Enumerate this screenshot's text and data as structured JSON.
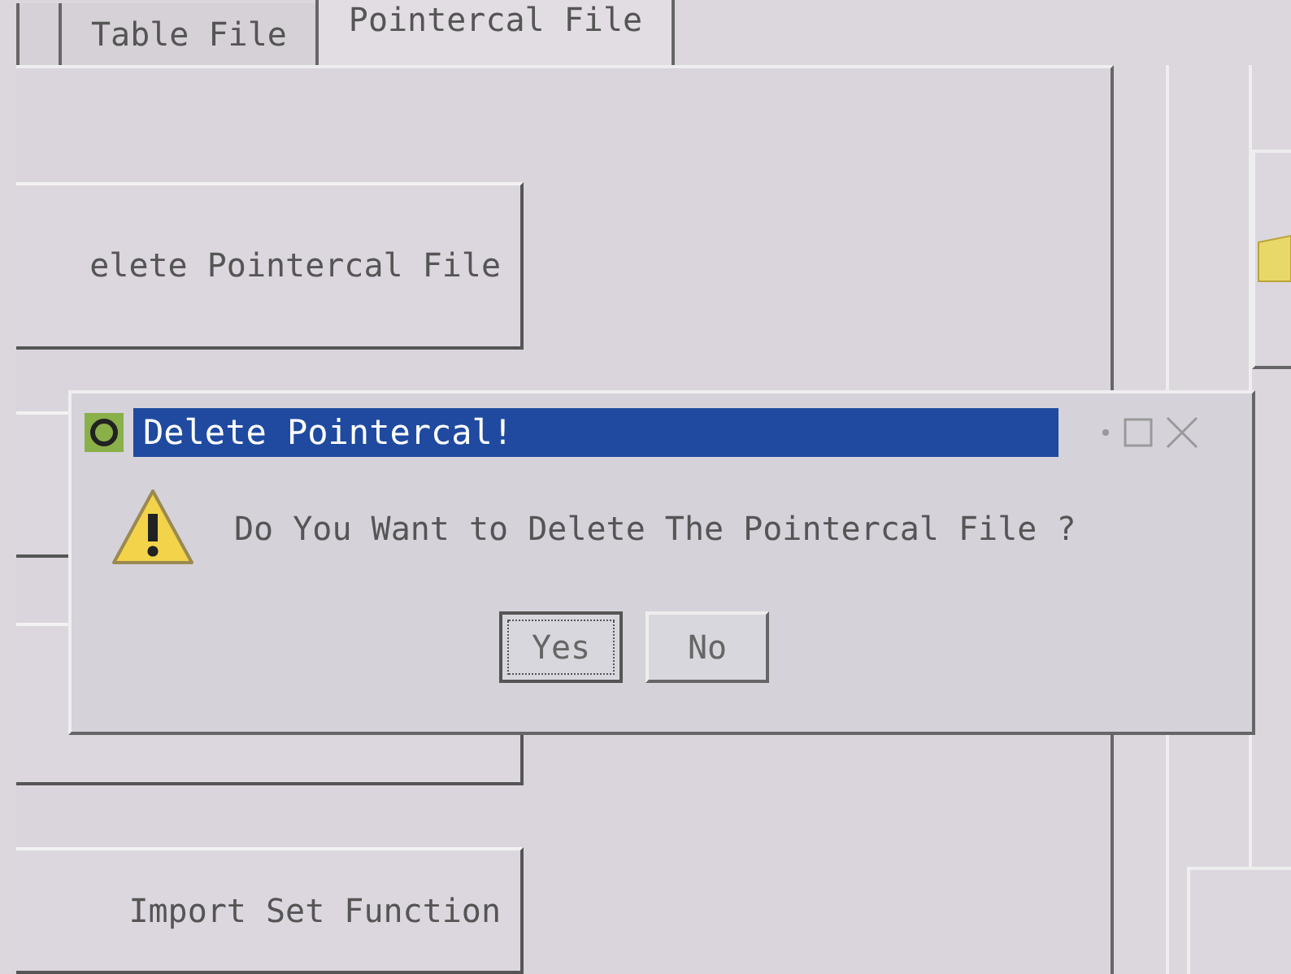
{
  "tabs": [
    {
      "selected": false
    },
    {
      "label": "Table File",
      "selected": false
    },
    {
      "label": "Pointercal File",
      "selected": true
    }
  ],
  "panel_buttons": [
    {
      "label": "elete Pointercal File"
    },
    {
      "label": "Import Set Function"
    }
  ],
  "dialog": {
    "title": "Delete Pointercal!",
    "message": "Do You Want to Delete The Pointercal File ?",
    "buttons": [
      {
        "label": "Yes",
        "focused": true
      },
      {
        "label": "No",
        "focused": false
      }
    ]
  }
}
